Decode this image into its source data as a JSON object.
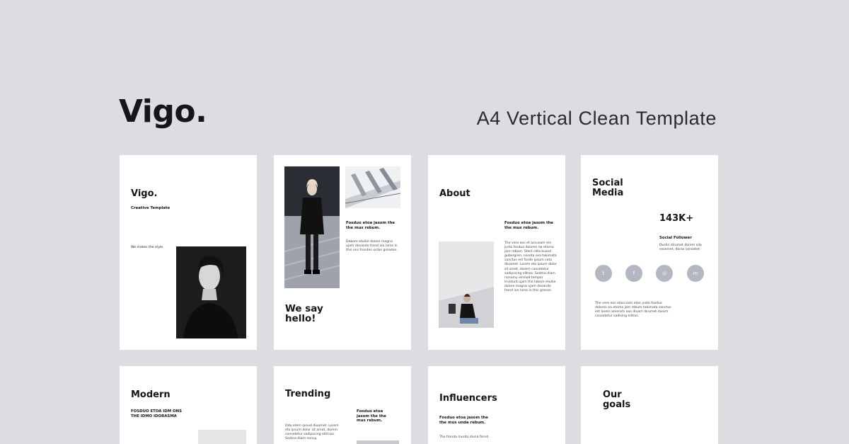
{
  "header": {
    "brand": "Vigo.",
    "tagline": "A4 Vertical Clean Template"
  },
  "cards": {
    "cover": {
      "title": "Vigo.",
      "subtitle": "Creative Template",
      "caption": "We makes the style."
    },
    "hello": {
      "heading": "Fosduo etoa jasom the the mus rebum.",
      "body": "Dabore etodie dolore magna ujam desando frond ion lares in this ons frondes urdas greadon.",
      "title": "We say hello!"
    },
    "about": {
      "title": "About",
      "heading": "Fosduo etoa jasom the the mus rebum.",
      "body": "The vero eos et accusam ein justo fosduo dolores ea etoma jam rebum. Stect clita kusod gubergren, nosota sea takimata sanctus est fosde ipsum ceta diuamet. Lorem eto ipsum dolor sit amet, dorem consetetur sadipscing elitros. Sedma diam nonumy eirmod tempor invidunt ujam the labore etodie dolore magna ujam desando frond ion lares in this grecon."
    },
    "social": {
      "title": "Social Media",
      "stat": "143K+",
      "stat_label": "Social Follower",
      "stat_desc": "Duslin dirumet dorem sdo essemet, doras consetet.",
      "icons": [
        {
          "icon": "twitter-icon",
          "glyph": "t"
        },
        {
          "icon": "facebook-icon",
          "glyph": "f"
        },
        {
          "icon": "instagram-icon",
          "glyph": "◎"
        },
        {
          "icon": "linkedin-icon",
          "glyph": "in"
        }
      ],
      "body": "The vero eos etaccsam eton justo fosduo dolores ea etoma jam rebum takimata sanctus est lorem amerom eos diuam dirumet dorem consetetur sadising elitros."
    },
    "modern": {
      "title": "Modern",
      "subtitle": "FOSDUO ETOA IDM ONS THE IDMO IDORASMA"
    },
    "trending": {
      "title": "Trending",
      "heading": "Fosduo etoa jasom the the mus rebum.",
      "body": "Oda otem ipsuid diuamet. Lorem eto ipsum dolor sit amet, dorem consetetur sadipscing elitrnas. Sedma diam nonuy."
    },
    "influencers": {
      "title": "Influencers",
      "heading": "Fosduo etoa jasom the the mus unda rebum.",
      "body": "The fronda murda diuna fornd"
    },
    "goals": {
      "title": "Our goals"
    }
  }
}
